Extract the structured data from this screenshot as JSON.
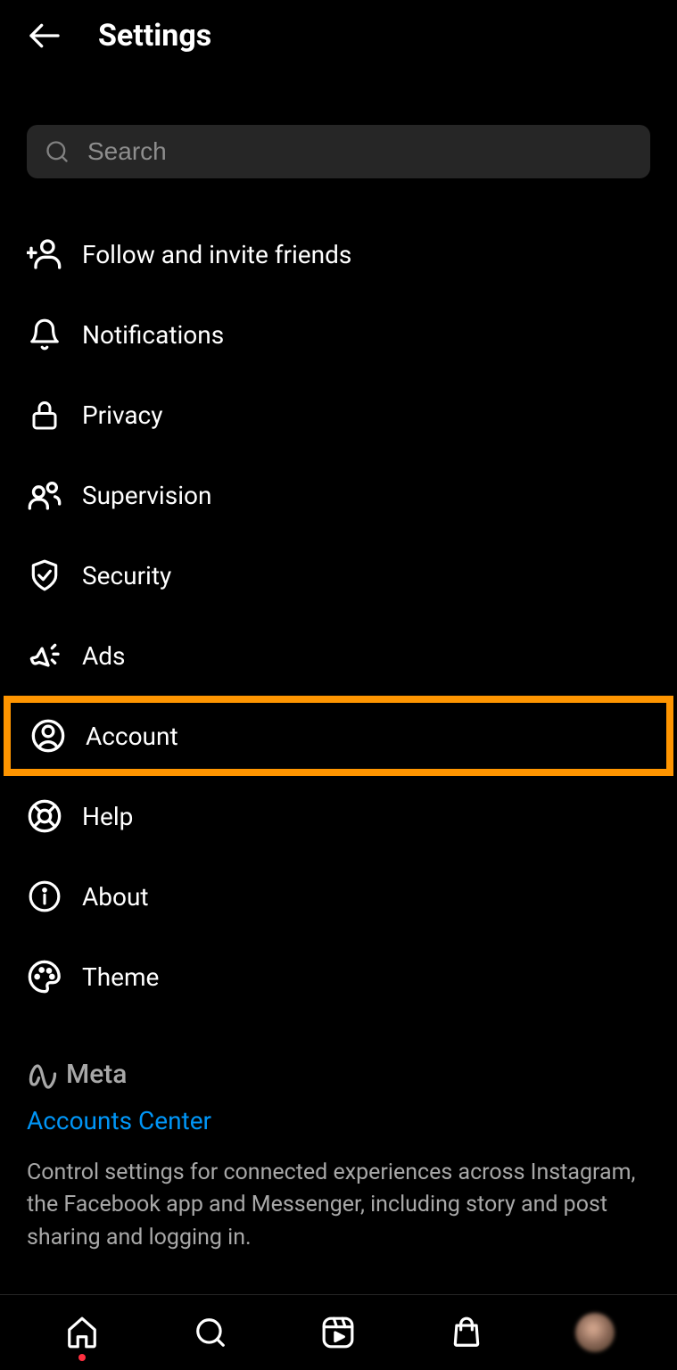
{
  "header": {
    "title": "Settings"
  },
  "search": {
    "placeholder": "Search",
    "value": ""
  },
  "menu": {
    "items": [
      {
        "label": "Follow and invite friends",
        "icon": "person-add-icon"
      },
      {
        "label": "Notifications",
        "icon": "bell-icon"
      },
      {
        "label": "Privacy",
        "icon": "lock-icon"
      },
      {
        "label": "Supervision",
        "icon": "people-icon"
      },
      {
        "label": "Security",
        "icon": "shield-check-icon"
      },
      {
        "label": "Ads",
        "icon": "megaphone-icon"
      },
      {
        "label": "Account",
        "icon": "user-circle-icon",
        "highlighted": true
      },
      {
        "label": "Help",
        "icon": "lifebuoy-icon"
      },
      {
        "label": "About",
        "icon": "info-icon"
      },
      {
        "label": "Theme",
        "icon": "palette-icon"
      }
    ]
  },
  "meta": {
    "brand": "Meta",
    "link_label": "Accounts Center",
    "description": "Control settings for connected experiences across Instagram, the Facebook app and Messenger, including story and post sharing and logging in."
  },
  "highlight_color": "#ff9500",
  "link_color": "#0095f6"
}
